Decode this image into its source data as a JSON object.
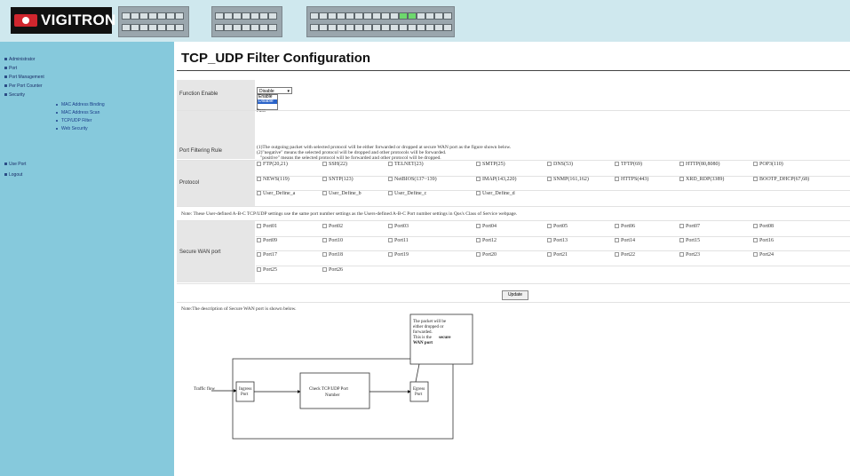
{
  "logo": {
    "text": "VIGITRON"
  },
  "sidebar": {
    "items": [
      {
        "label": "Administrator"
      },
      {
        "label": "Port"
      },
      {
        "label": "Port Management"
      },
      {
        "label": "Per Port Counter"
      },
      {
        "label": "Security"
      }
    ],
    "security_items": [
      {
        "label": "MAC Address Binding"
      },
      {
        "label": "MAC Address Scan"
      },
      {
        "label": "TCP/UDP Filter"
      },
      {
        "label": "Web Security"
      }
    ],
    "bottom_items": [
      {
        "label": "Use Port"
      },
      {
        "label": "Logout"
      }
    ]
  },
  "page": {
    "title": "TCP_UDP Filter Configuration"
  },
  "function_enable": {
    "label": "Function Enable",
    "selected": "Disable",
    "options": [
      "Enable",
      "Disable"
    ],
    "extra": "Pass"
  },
  "filter_rule": {
    "label": "Port Filtering Rule",
    "line1": "(1)The outgoing packet with selected protocol will be either forwarded or dropped at secure WAN port as the figure shown below.",
    "line2": "(2)\"negative\" means the selected protocol will be dropped and other protocols will be forwarded.",
    "line3": "\"positive\" means the selected protocol will be forwarded and other protocol will be dropped."
  },
  "protocol": {
    "label": "Protocol",
    "rows": [
      [
        "FTP(20,21)",
        "SSH(22)",
        "TELNET(23)",
        "SMTP(25)",
        "DNS(53)",
        "TFTP(69)",
        "HTTP(80,8080)",
        "POP3(110)"
      ],
      [
        "NEWS(119)",
        "SNTP(123)",
        "NetBIOS(137~139)",
        "IMAP(143,220)",
        "SNMP(161,162)",
        "HTTPS(443)",
        "XRD_RDP(3389)",
        "BOOTP_DHCP(67,68)"
      ],
      [
        "User_Define_a",
        "User_Define_b",
        "User_Define_c",
        "User_Define_d"
      ]
    ]
  },
  "note1": "Note: These User-defined A-B-C TCP/UDP settings use the same port number settings as the Users-defined A-B-C Port number settings in Qos's Class of Service webpage.",
  "secure_wan": {
    "label": "Secure WAN port",
    "ports": [
      "Port01",
      "Port02",
      "Port03",
      "Port04",
      "Port05",
      "Port06",
      "Port07",
      "Port08",
      "Port09",
      "Port10",
      "Port11",
      "Port12",
      "Port13",
      "Port14",
      "Port15",
      "Port16",
      "Port17",
      "Port18",
      "Port19",
      "Port20",
      "Port21",
      "Port22",
      "Port23",
      "Port24",
      "Port25",
      "Port26"
    ]
  },
  "update_button": "Update",
  "note2": "Note:The description of Secure WAN port is shown below.",
  "diagram": {
    "callout_lines": [
      "The packet will be",
      "either dropped or",
      "forwarded.",
      "This is the "
    ],
    "callout_bold": "secure",
    "callout_bold2": "WAN port",
    "traffic": "Traffic flow",
    "ingress_1": "Ingress",
    "ingress_2": "Port",
    "check_1": "Check  TCP/UDP Port",
    "check_2": "Number",
    "egress_1": "Egress",
    "egress_2": "Port"
  }
}
